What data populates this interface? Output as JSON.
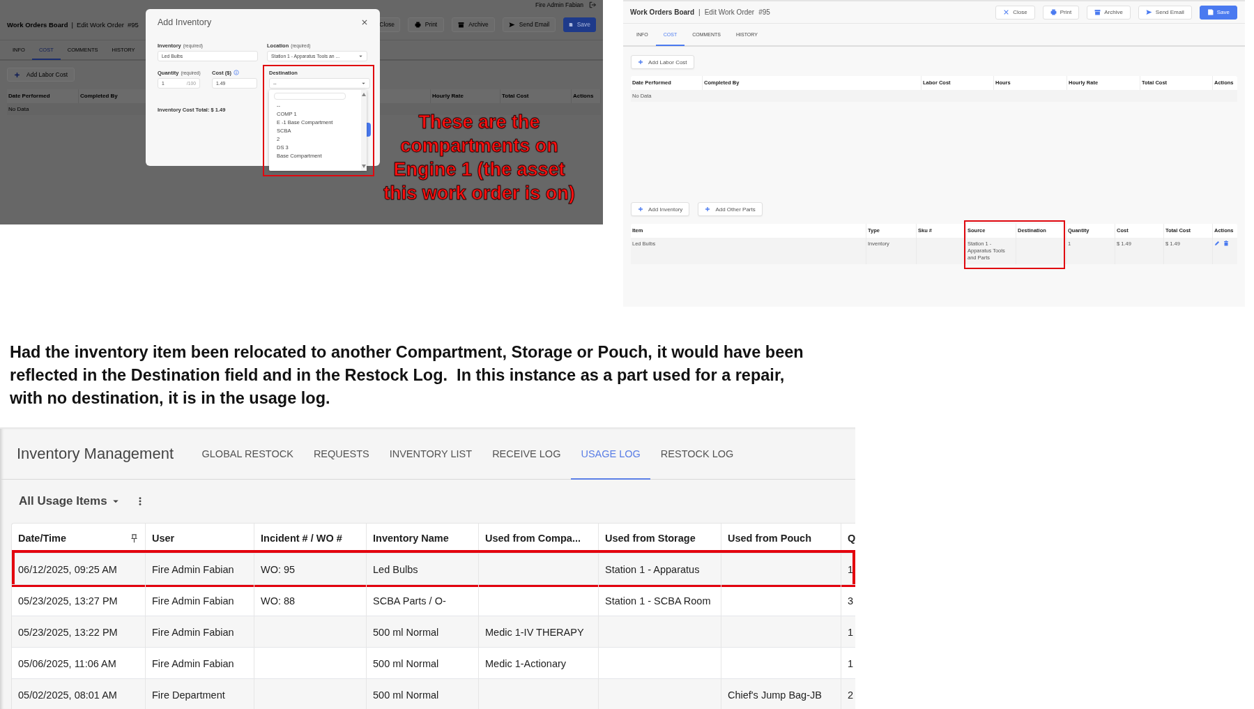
{
  "dimmed_screen": {
    "user": "Fire Admin Fabian",
    "title": "Work Orders Board",
    "separator": "|",
    "subtitle": "Edit Work Order",
    "number": "#95",
    "actions": [
      {
        "label": "Close",
        "kind": "close"
      },
      {
        "label": "Print",
        "kind": "print"
      },
      {
        "label": "Archive",
        "kind": "archive"
      },
      {
        "label": "Send Email",
        "kind": "send"
      },
      {
        "label": "Save",
        "kind": "save"
      }
    ],
    "tabs": [
      {
        "label": "INFO",
        "selected": false
      },
      {
        "label": "COST",
        "selected": true
      },
      {
        "label": "COMMENTS",
        "selected": false
      },
      {
        "label": "HISTORY",
        "selected": false
      }
    ],
    "add_labor_button": "Add Labor Cost",
    "labor_columns": [
      "Date Performed",
      "Completed By",
      "Hourly Rate",
      "Total Cost",
      "Actions"
    ],
    "labor_empty": "No Data",
    "modal": {
      "title": "Add Inventory",
      "inventory": {
        "label": "Inventory",
        "hint": "(required)",
        "value": "Led Bulbs"
      },
      "location": {
        "label": "Location",
        "hint": "(required)",
        "value": "Station 1 - Apparatus Tools an ..."
      },
      "quantity": {
        "label": "Quantity",
        "hint": "(required)",
        "value": "1",
        "max": "/100"
      },
      "cost": {
        "label": "Cost ($)",
        "value": "1.49"
      },
      "destination": {
        "label": "Destination",
        "value": "--",
        "options": [
          "--",
          "COMP 1",
          "E -1 Base Compartment",
          "SCBA",
          "2",
          "DS 3",
          "Base Compartment"
        ]
      },
      "total": "Inventory Cost Total: $ 1.49"
    },
    "annotation": "These are the compartments on Engine 1 (the asset this work order is on)"
  },
  "edit_screen": {
    "title": "Work Orders Board",
    "separator": "|",
    "subtitle": "Edit Work Order",
    "number": "#95",
    "actions": [
      {
        "label": "Close",
        "kind": "close"
      },
      {
        "label": "Print",
        "kind": "print"
      },
      {
        "label": "Archive",
        "kind": "archive"
      },
      {
        "label": "Send Email",
        "kind": "send"
      },
      {
        "label": "Save",
        "kind": "save"
      }
    ],
    "tabs": [
      {
        "label": "INFO",
        "selected": false
      },
      {
        "label": "COST",
        "selected": true
      },
      {
        "label": "COMMENTS",
        "selected": false
      },
      {
        "label": "HISTORY",
        "selected": false
      }
    ],
    "add_labor_button": "Add Labor Cost",
    "labor_columns": [
      "Date Performed",
      "Completed By",
      "Labor Cost",
      "Hours",
      "Hourly Rate",
      "Total Cost",
      "Actions"
    ],
    "labor_empty": "No Data",
    "parts_buttons": [
      "Add Inventory",
      "Add Other Parts"
    ],
    "parts_columns": [
      "Item",
      "Type",
      "Sku #",
      "Source",
      "Destination",
      "Quantity",
      "Cost",
      "Total Cost",
      "Actions"
    ],
    "parts_rows": [
      {
        "cells": [
          "Led Bulbs",
          "Inventory",
          null,
          "Station 1 - Apparatus Tools and Parts",
          null,
          "1",
          "$ 1.49",
          "$ 1.49"
        ]
      }
    ]
  },
  "note": "Had the inventory item been relocated to another Compartment, Storage or Pouch, it would have been reflected in the Destination field and in the Restock Log.  In this instance as a part used for a repair, with no destination, it is in the usage log.",
  "usage_screen": {
    "title": "Inventory Management",
    "tabs": [
      {
        "label": "GLOBAL RESTOCK",
        "selected": false
      },
      {
        "label": "REQUESTS",
        "selected": false
      },
      {
        "label": "INVENTORY LIST",
        "selected": false
      },
      {
        "label": "RECEIVE LOG",
        "selected": false
      },
      {
        "label": "USAGE LOG",
        "selected": true
      },
      {
        "label": "RESTOCK LOG",
        "selected": false
      }
    ],
    "view": "All Usage Items",
    "columns": [
      "Date/Time",
      "User",
      "Incident # / WO #",
      "Inventory Name",
      "Used from Compa...",
      "Used from Storage",
      "Used from Pouch",
      "Q"
    ],
    "rows": [
      {
        "cells": [
          "06/12/2025, 09:25 AM",
          "Fire Admin Fabian",
          "WO: 95",
          "Led Bulbs",
          null,
          "Station 1 - Apparatus",
          null,
          "1"
        ],
        "outlined": true
      },
      {
        "cells": [
          "05/23/2025, 13:27 PM",
          "Fire Admin Fabian",
          "WO: 88",
          "SCBA Parts / O-",
          null,
          "Station 1 - SCBA Room",
          null,
          "3"
        ],
        "outlined": false
      },
      {
        "cells": [
          "05/23/2025, 13:22 PM",
          "Fire Admin Fabian",
          null,
          "500 ml Normal",
          "Medic 1-IV THERAPY",
          null,
          null,
          "1"
        ],
        "outlined": false
      },
      {
        "cells": [
          "05/06/2025, 11:06 AM",
          "Fire Admin Fabian",
          null,
          "500 ml Normal",
          "Medic 1-Actionary",
          null,
          null,
          "1"
        ],
        "outlined": false
      },
      {
        "cells": [
          "05/02/2025, 08:01 AM",
          "Fire Department",
          null,
          "500 ml Normal",
          null,
          null,
          "Chief's Jump Bag-JB",
          "2"
        ],
        "outlined": false
      }
    ]
  }
}
